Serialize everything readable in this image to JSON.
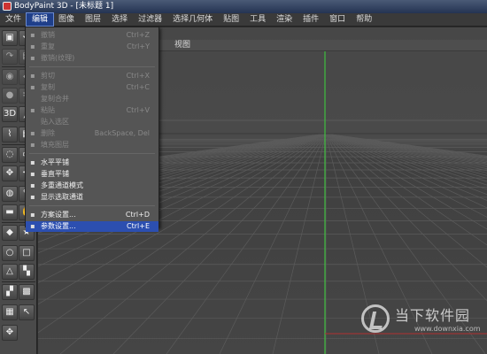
{
  "window": {
    "title": "BodyPaint 3D - [未标题 1]"
  },
  "menubar": {
    "items": [
      "文件",
      "编辑",
      "图像",
      "图层",
      "选择",
      "过滤器",
      "选择几何体",
      "贴图",
      "工具",
      "渲染",
      "插件",
      "窗口",
      "帮助"
    ],
    "active": "编辑"
  },
  "viewport": {
    "menu_label": "视图",
    "axis_color": "#3fbf3f",
    "axis_x_color": "#b23030"
  },
  "edit_menu": {
    "items": [
      {
        "label": "撤销",
        "shortcut": "Ctrl+Z",
        "enabled": false,
        "icon": "undo-icon"
      },
      {
        "label": "重复",
        "shortcut": "Ctrl+Y",
        "enabled": false,
        "icon": "redo-icon"
      },
      {
        "label": "撤销(纹理)",
        "shortcut": "",
        "enabled": false,
        "icon": "undo-texture-icon"
      },
      {
        "label": "剪切",
        "shortcut": "Ctrl+X",
        "enabled": false,
        "icon": "cut-icon"
      },
      {
        "label": "复制",
        "shortcut": "Ctrl+C",
        "enabled": false,
        "icon": "copy-icon"
      },
      {
        "label": "复制合并",
        "shortcut": "",
        "enabled": false,
        "icon": ""
      },
      {
        "label": "粘贴",
        "shortcut": "Ctrl+V",
        "enabled": false,
        "icon": "paste-icon"
      },
      {
        "label": "贴入选区",
        "shortcut": "",
        "enabled": false,
        "icon": ""
      },
      {
        "label": "删除",
        "shortcut": "BackSpace, Del",
        "enabled": false,
        "icon": "delete-icon"
      },
      {
        "label": "填充图层",
        "shortcut": "",
        "enabled": false,
        "icon": "fill-layer-icon"
      },
      {
        "label": "水平平铺",
        "shortcut": "",
        "enabled": true,
        "icon": "tile-horizontal-icon"
      },
      {
        "label": "垂直平铺",
        "shortcut": "",
        "enabled": true,
        "icon": "tile-vertical-icon"
      },
      {
        "label": "多重通道模式",
        "shortcut": "",
        "enabled": true,
        "icon": "multi-channel-icon"
      },
      {
        "label": "显示选取通道",
        "shortcut": "",
        "enabled": true,
        "icon": "show-channel-icon"
      },
      {
        "label": "方案设置...",
        "shortcut": "Ctrl+D",
        "enabled": true,
        "icon": "scheme-settings-icon"
      },
      {
        "label": "参数设置...",
        "shortcut": "Ctrl+E",
        "enabled": true,
        "icon": "preferences-icon",
        "highlighted": true
      }
    ]
  },
  "toolbar": {
    "tools": [
      {
        "icon": "film-icon",
        "glyph": "▣"
      },
      {
        "icon": "undo-icon",
        "glyph": "↶"
      },
      {
        "icon": "redo-icon",
        "glyph": "↷"
      },
      {
        "icon": "layer-icon",
        "glyph": "▤"
      },
      {
        "icon": "eye-icon",
        "glyph": "◉"
      },
      {
        "icon": "paint-bucket-icon",
        "glyph": "◆"
      },
      {
        "icon": "record-icon",
        "glyph": "●"
      },
      {
        "icon": "scissor-icon",
        "glyph": "✂"
      },
      {
        "icon": "3d-paint-icon",
        "glyph": "3D"
      },
      {
        "icon": "brush-icon",
        "glyph": "╱"
      },
      {
        "icon": "eyedropper-icon",
        "glyph": "⌇"
      },
      {
        "icon": "pattern-icon",
        "glyph": "▦"
      },
      {
        "icon": "lasso-icon",
        "glyph": "◌"
      },
      {
        "icon": "select-rect-icon",
        "glyph": "▭"
      },
      {
        "icon": "transform-icon",
        "glyph": "✥"
      },
      {
        "icon": "move-icon",
        "glyph": "✢"
      },
      {
        "icon": "clone-icon",
        "glyph": "◍"
      },
      {
        "icon": "pen-icon",
        "glyph": "✎"
      },
      {
        "icon": "eraser-icon",
        "glyph": "▬"
      },
      {
        "icon": "smudge-icon",
        "glyph": "✋"
      },
      {
        "icon": "fill-icon",
        "glyph": "◆"
      },
      {
        "icon": "star-icon",
        "glyph": "★"
      },
      {
        "icon": "circle-icon",
        "glyph": "○"
      },
      {
        "icon": "square-icon",
        "glyph": "□"
      },
      {
        "icon": "uv-icon",
        "glyph": "△"
      },
      {
        "icon": "checker-icon",
        "glyph": "▚"
      },
      {
        "icon": "checker2-icon",
        "glyph": "▞"
      },
      {
        "icon": "grid-icon",
        "glyph": "▩"
      },
      {
        "icon": "grid2-icon",
        "glyph": "▦"
      },
      {
        "icon": "pointer-icon",
        "glyph": "↖"
      },
      {
        "icon": "move-arrows-icon",
        "glyph": "✥"
      }
    ]
  },
  "watermark": {
    "title": "当下软件园",
    "url": "www.downxia.com"
  }
}
